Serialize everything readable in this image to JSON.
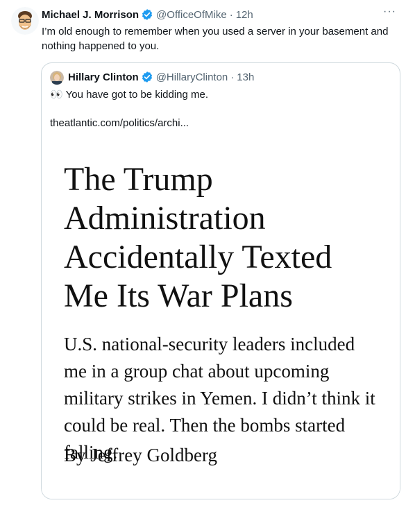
{
  "tweet": {
    "author_name": "Michael J. Morrison",
    "handle": "@OfficeOfMike",
    "time": "12h",
    "separator": "·",
    "text": "I’m old enough to remember when you used a server in your basement and nothing happened to you.",
    "more_icon": "···"
  },
  "quote": {
    "author_name": "Hillary Clinton",
    "handle": "@HillaryClinton",
    "time": "13h",
    "separator": "·",
    "emoji": "👀",
    "text": "You have got to be kidding me.",
    "link": "theatlantic.com/politics/archi..."
  },
  "article": {
    "headline": "The Trump Administration Accidentally Texted Me Its War Plans",
    "dek": "U.S. national-security leaders included me in a group chat about upcoming military strikes in Yemen. I didn’t think it could be real. Then the bombs started falling.",
    "byline": "By Jeffrey Goldberg"
  },
  "colors": {
    "verified": "#1d9bf0",
    "secondary_text": "#536471",
    "border": "#cfd9de"
  }
}
